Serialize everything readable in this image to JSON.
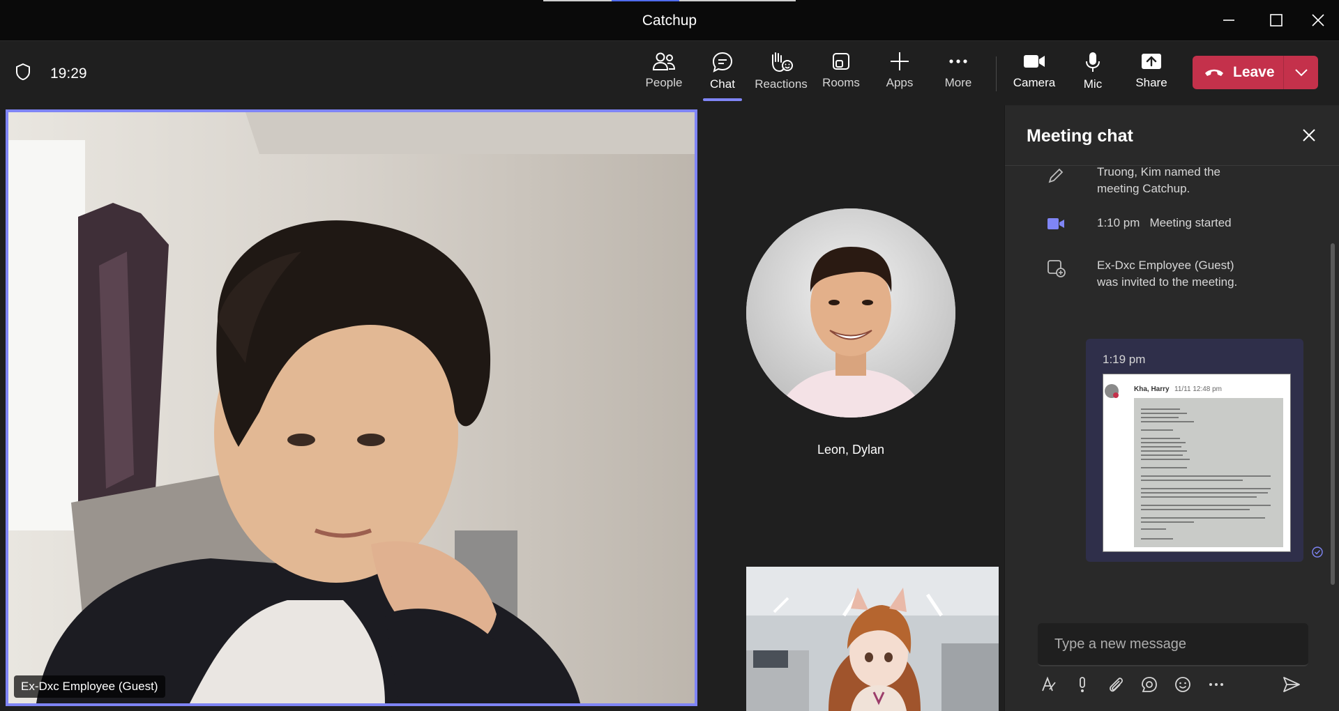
{
  "window": {
    "title": "Catchup",
    "progress": 0.27,
    "controls": [
      "minimize-icon",
      "maximize-icon",
      "close-icon"
    ]
  },
  "toolbar": {
    "time": "19:29",
    "buttons": [
      {
        "label": "People",
        "icon": "people-icon"
      },
      {
        "label": "Chat",
        "icon": "chat-icon",
        "active": true
      },
      {
        "label": "Reactions",
        "icon": "raise-hand-icon"
      },
      {
        "label": "Rooms",
        "icon": "rooms-icon"
      },
      {
        "label": "Apps",
        "icon": "plus-icon"
      },
      {
        "label": "More",
        "icon": "more-icon"
      },
      {
        "label": "Camera",
        "icon": "camera-icon"
      },
      {
        "label": "Mic",
        "icon": "mic-icon"
      },
      {
        "label": "Share",
        "icon": "share-icon"
      }
    ],
    "leave_label": "Leave",
    "accent": "#7f85f5",
    "leave_color": "#c4314b"
  },
  "stage": {
    "main_participant": "Ex-Dxc Employee (Guest)",
    "avatar_participant": "Leon, Dylan"
  },
  "chat": {
    "title": "Meeting chat",
    "events": [
      {
        "icon": "pencil-icon",
        "text": "Truong, Kim named the meeting Catchup."
      },
      {
        "icon": "video-camera-icon",
        "time": "1:10 pm",
        "text": "Meeting started"
      },
      {
        "icon": "calendar-add-icon",
        "text": "Ex-Dxc Employee (Guest) was invited to the meeting."
      }
    ],
    "message": {
      "time": "1:19 pm",
      "image_author": "Kha, Harry",
      "image_timestamp": "11/11 12:48 pm"
    },
    "composer_placeholder": "Type a new message",
    "tools": [
      "format-icon",
      "important-icon",
      "attach-icon",
      "loop-icon",
      "emoji-icon",
      "more-icon"
    ]
  }
}
